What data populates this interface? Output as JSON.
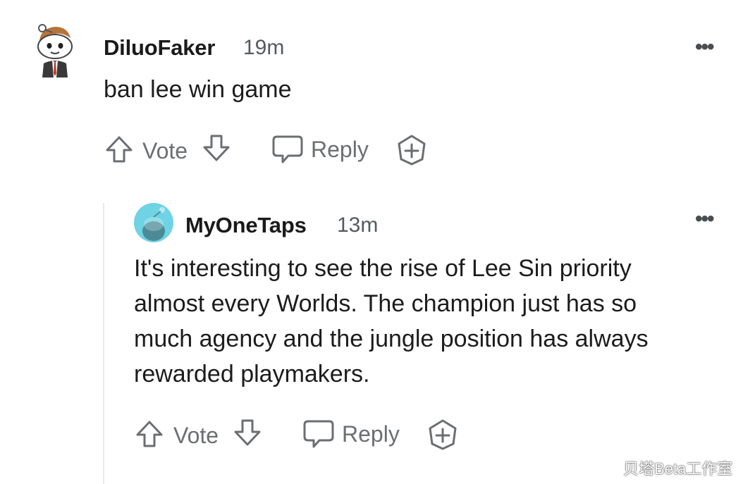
{
  "comments": [
    {
      "username": "DiluoFaker",
      "time": "19m",
      "body": "ban lee win game",
      "actions": {
        "vote_label": "Vote",
        "reply_label": "Reply"
      },
      "more_label": "•••",
      "avatar_icon": "snoo-avatar-business-suit"
    },
    {
      "username": "MyOneTaps",
      "time": "13m",
      "body": "It's interesting to see the rise of Lee Sin priority almost every Worlds. The champion just has so much agency and the jungle position has always rewarded playmakers.",
      "actions": {
        "vote_label": "Vote",
        "reply_label": "Reply"
      },
      "more_label": "•••",
      "avatar_icon": "snoo-avatar-teal"
    }
  ],
  "watermark": "贝塔Beta工作室",
  "colors": {
    "text": "#1c1c1c",
    "muted": "#6b6e72",
    "avatar_teal": "#6fd3e3"
  }
}
